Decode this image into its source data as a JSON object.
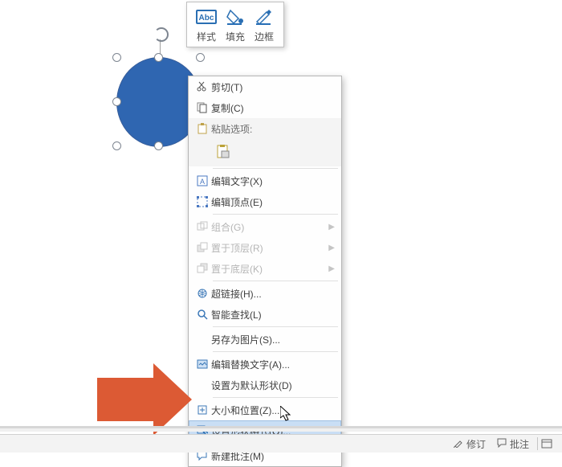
{
  "toolbar": {
    "style_label": "样式",
    "fill_label": "填充",
    "outline_label": "边框"
  },
  "context_menu": {
    "cut": "剪切(T)",
    "copy": "复制(C)",
    "paste_options_header": "粘贴选项:",
    "edit_text": "编辑文字(X)",
    "edit_points": "编辑顶点(E)",
    "group": "组合(G)",
    "bring_to_front": "置于顶层(R)",
    "send_to_back": "置于底层(K)",
    "hyperlink": "超链接(H)...",
    "smart_lookup": "智能查找(L)",
    "save_as_picture": "另存为图片(S)...",
    "edit_alt_text": "编辑替换文字(A)...",
    "set_as_default_shape": "设置为默认形状(D)",
    "size_and_position": "大小和位置(Z)...",
    "format_shape": "设置形状格式(O)...",
    "new_comment": "新建批注(M)"
  },
  "status": {
    "revisions": "修订",
    "comments": "批注"
  }
}
